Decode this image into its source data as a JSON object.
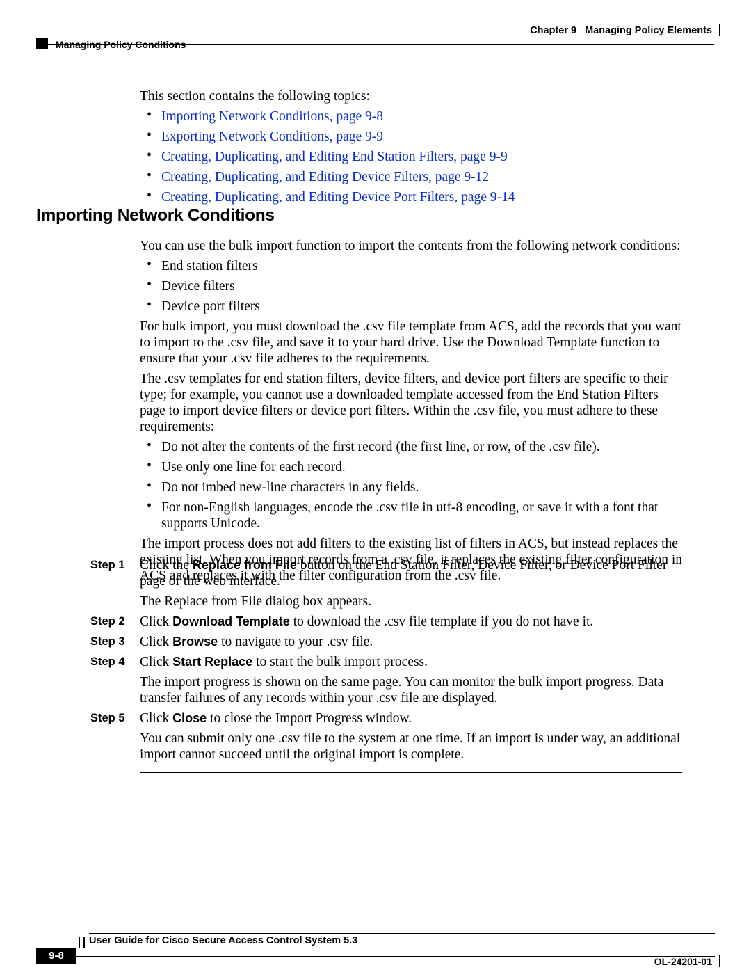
{
  "header": {
    "chapter_num": "Chapter 9",
    "chapter_title": "Managing Policy Elements",
    "section": "Managing Policy Conditions"
  },
  "intro": {
    "lead": "This section contains the following topics:",
    "links": [
      "Importing Network Conditions, page 9-8",
      "Exporting Network Conditions, page 9-9",
      "Creating, Duplicating, and Editing End Station Filters, page 9-9",
      "Creating, Duplicating, and Editing Device Filters, page 9-12",
      "Creating, Duplicating, and Editing Device Port Filters, page 9-14"
    ]
  },
  "section": {
    "heading": "Importing Network Conditions",
    "p1": "You can use the bulk import function to import the contents from the following network conditions:",
    "bullets1": [
      "End station filters",
      "Device filters",
      "Device port filters"
    ],
    "p2": "For bulk import, you must download the .csv file template from ACS, add the records that you want to import to the .csv file, and save it to your hard drive. Use the Download Template function to ensure that your .csv file adheres to the requirements.",
    "p3": "The .csv templates for end station filters, device filters, and device port filters are specific to their type; for example, you cannot use a downloaded template accessed from the End Station Filters page to import device filters or device port filters. Within the .csv file, you must adhere to these requirements:",
    "bullets2": [
      "Do not alter the contents of the first record (the first line, or row, of the .csv file).",
      "Use only one line for each record.",
      "Do not imbed new-line characters in any fields.",
      "For non-English languages, encode the .csv file in utf-8 encoding, or save it with a font that supports Unicode."
    ],
    "p4": "The import process does not add filters to the existing list of filters in ACS, but instead replaces the existing list. When you import records from a .csv file, it replaces the existing filter configuration in ACS and replaces it with the filter configuration from the .csv file."
  },
  "steps": [
    {
      "n": "Step 1",
      "pre": "Click the ",
      "bold": "Replace from File",
      "post": " button on the End Station Filter, Device Filter, or Device Port Filter page of the web interface.",
      "after": "The Replace from File dialog box appears."
    },
    {
      "n": "Step 2",
      "pre": "Click ",
      "bold": "Download Template",
      "post": " to download the .csv file template if you do not have it."
    },
    {
      "n": "Step 3",
      "pre": "Click ",
      "bold": "Browse",
      "post": " to navigate to your .csv file."
    },
    {
      "n": "Step 4",
      "pre": "Click ",
      "bold": "Start Replace",
      "post": " to start the bulk import process.",
      "after": "The import progress is shown on the same page. You can monitor the bulk import progress. Data transfer failures of any records within your .csv file are displayed."
    },
    {
      "n": "Step 5",
      "pre": "Click ",
      "bold": "Close",
      "post": " to close the Import Progress window.",
      "after": "You can submit only one .csv file to the system at one time. If an import is under way, an additional import cannot succeed until the original import is complete."
    }
  ],
  "footer": {
    "guide": "User Guide for Cisco Secure Access Control System 5.3",
    "page": "9-8",
    "doc": "OL-24201-01"
  }
}
